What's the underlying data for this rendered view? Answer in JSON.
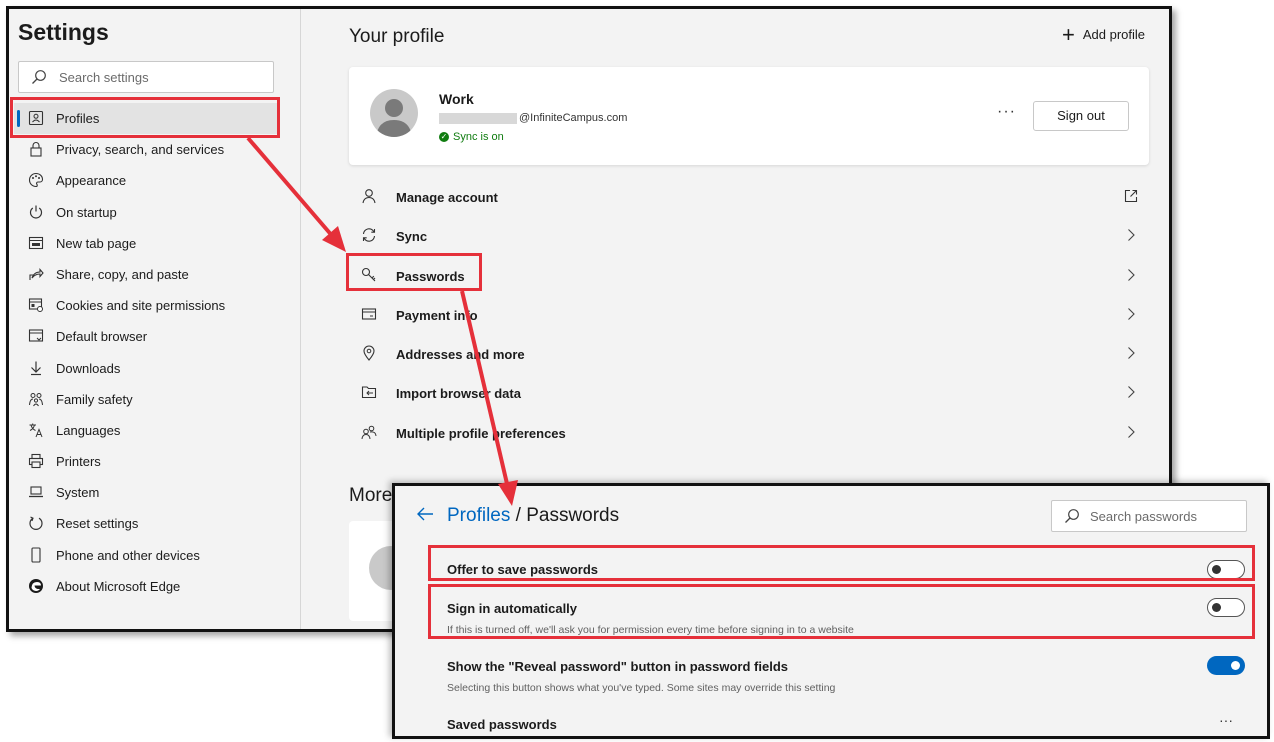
{
  "sidebar": {
    "title": "Settings",
    "search_placeholder": "Search settings",
    "items": [
      {
        "label": "Profiles",
        "icon": "profile-card-icon"
      },
      {
        "label": "Privacy, search, and services",
        "icon": "lock-icon"
      },
      {
        "label": "Appearance",
        "icon": "palette-icon"
      },
      {
        "label": "On startup",
        "icon": "power-icon"
      },
      {
        "label": "New tab page",
        "icon": "new-tab-icon"
      },
      {
        "label": "Share, copy, and paste",
        "icon": "share-icon"
      },
      {
        "label": "Cookies and site permissions",
        "icon": "cookies-icon"
      },
      {
        "label": "Default browser",
        "icon": "browser-icon"
      },
      {
        "label": "Downloads",
        "icon": "download-icon"
      },
      {
        "label": "Family safety",
        "icon": "family-icon"
      },
      {
        "label": "Languages",
        "icon": "languages-icon"
      },
      {
        "label": "Printers",
        "icon": "printer-icon"
      },
      {
        "label": "System",
        "icon": "laptop-icon"
      },
      {
        "label": "Reset settings",
        "icon": "reset-icon"
      },
      {
        "label": "Phone and other devices",
        "icon": "phone-icon"
      },
      {
        "label": "About Microsoft Edge",
        "icon": "edge-logo-icon"
      }
    ]
  },
  "main": {
    "heading": "Your profile",
    "add_profile": "Add profile",
    "profile": {
      "name": "Work",
      "email": "@InfiniteCampus.com",
      "sync_status": "Sync is on",
      "more": "···",
      "sign_out": "Sign out"
    },
    "rows": [
      {
        "label": "Manage account",
        "icon": "person-icon",
        "action": "external-link-icon"
      },
      {
        "label": "Sync",
        "icon": "sync-icon",
        "action": "chevron-right-icon"
      },
      {
        "label": "Passwords",
        "icon": "key-icon",
        "action": "chevron-right-icon"
      },
      {
        "label": "Payment info",
        "icon": "card-icon",
        "action": "chevron-right-icon"
      },
      {
        "label": "Addresses and more",
        "icon": "location-icon",
        "action": "chevron-right-icon"
      },
      {
        "label": "Import browser data",
        "icon": "import-icon",
        "action": "chevron-right-icon"
      },
      {
        "label": "Multiple profile preferences",
        "icon": "profiles-icon",
        "action": "chevron-right-icon"
      }
    ],
    "more_heading": "More"
  },
  "passwords": {
    "breadcrumb_link": "Profiles",
    "breadcrumb_sep": " / ",
    "breadcrumb_current": "Passwords",
    "search_placeholder": "Search passwords",
    "settings": [
      {
        "label": "Offer to save passwords",
        "desc": "",
        "enabled": false
      },
      {
        "label": "Sign in automatically",
        "desc": "If this is turned off, we'll ask you for permission every time before signing in to a website",
        "enabled": false
      },
      {
        "label": "Show the \"Reveal password\" button in password fields",
        "desc": "Selecting this button shows what you've typed. Some sites may override this setting",
        "enabled": true
      }
    ],
    "saved_passwords": "Saved passwords",
    "saved_more": "···"
  },
  "colors": {
    "accent": "#0067c0",
    "highlight": "#e5303a",
    "sync_green": "#107c10"
  }
}
